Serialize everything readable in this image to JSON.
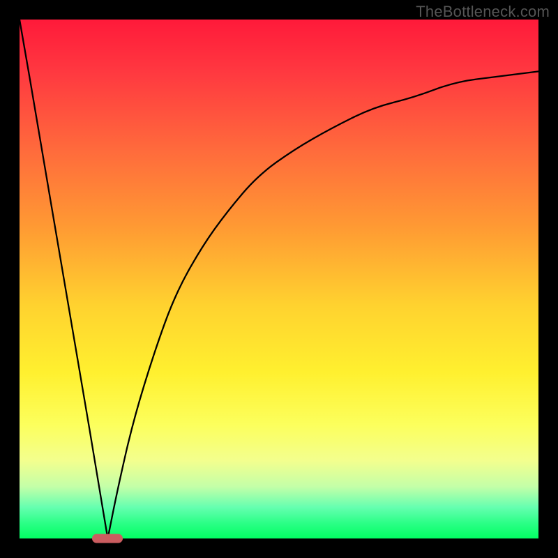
{
  "watermark": "TheBottleneck.com",
  "colors": {
    "frame": "#000000",
    "curve": "#000000",
    "marker": "#cb5d60",
    "gradient_top": "#ff1a3a",
    "gradient_bottom": "#02ff63"
  },
  "chart_data": {
    "type": "line",
    "title": "",
    "xlabel": "",
    "ylabel": "",
    "xlim": [
      0,
      100
    ],
    "ylim": [
      0,
      100
    ],
    "grid": false,
    "legend": false,
    "series": [
      {
        "name": "left-branch",
        "x": [
          0,
          4,
          8,
          12,
          15,
          17
        ],
        "y": [
          100,
          77,
          53,
          30,
          12,
          0
        ]
      },
      {
        "name": "right-branch",
        "x": [
          17,
          19,
          22,
          26,
          30,
          35,
          40,
          46,
          53,
          60,
          68,
          76,
          84,
          92,
          100
        ],
        "y": [
          0,
          10,
          23,
          36,
          47,
          56,
          63,
          70,
          75,
          79,
          83,
          85,
          88,
          89,
          90
        ]
      }
    ],
    "marker": {
      "x": 17,
      "y": 0,
      "shape": "pill"
    },
    "annotations": []
  }
}
